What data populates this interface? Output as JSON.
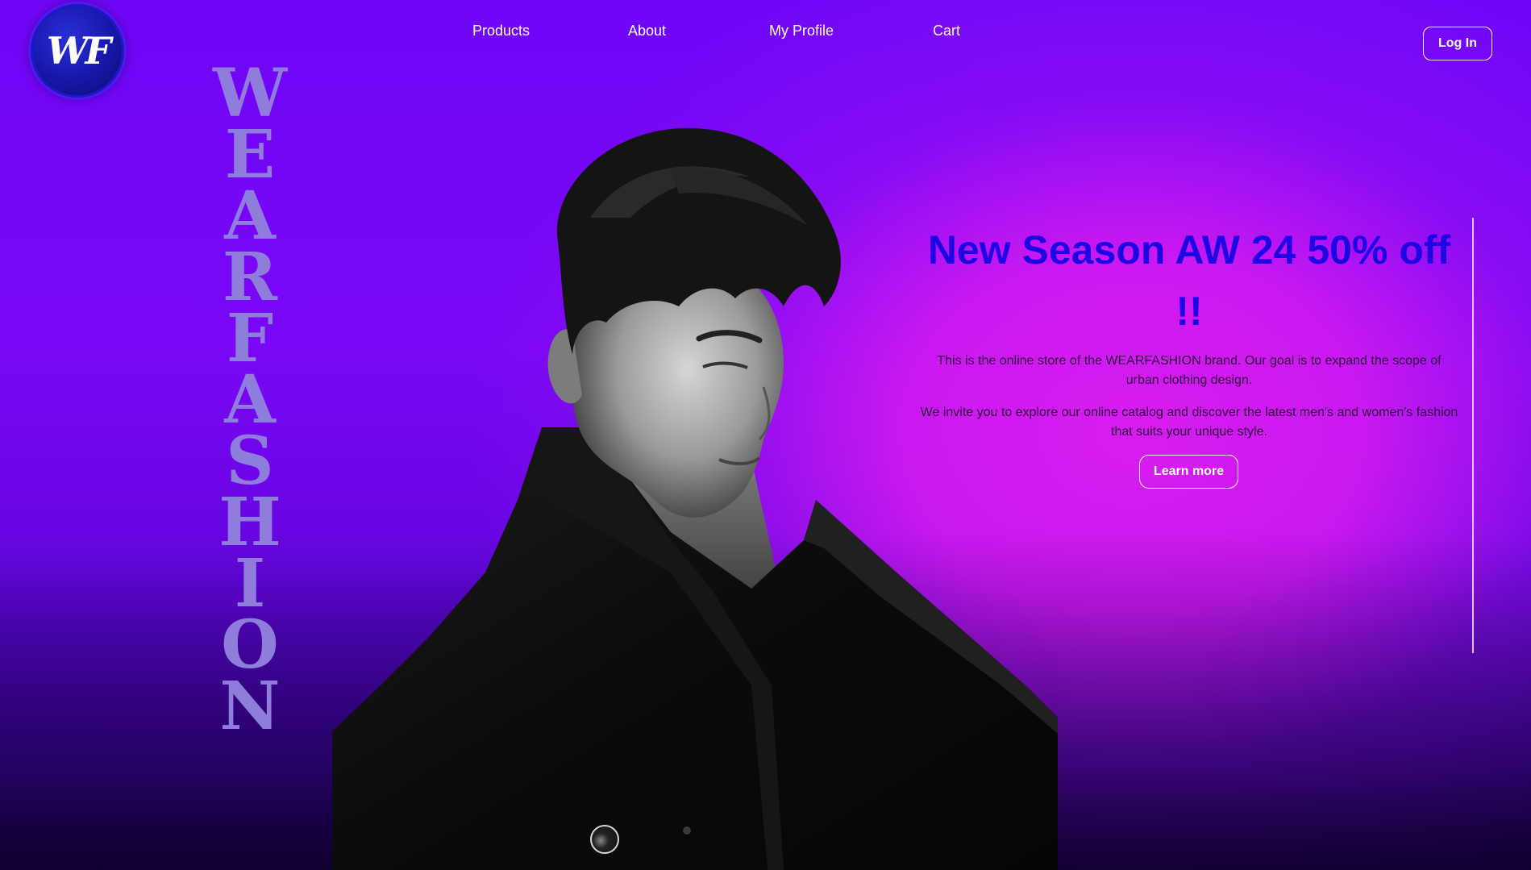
{
  "brand": {
    "logo_text": "WF",
    "vertical_name": "WEARFASHION"
  },
  "nav": {
    "items": [
      {
        "label": "Products"
      },
      {
        "label": "About"
      },
      {
        "label": "My Profile"
      },
      {
        "label": "Cart"
      }
    ],
    "login_label": "Log In"
  },
  "hero": {
    "headline": "New Season AW 24 50% off !!",
    "paragraph_1": "This is the online store of the WEARFASHION brand. Our goal is to expand the scope of urban clothing design.",
    "paragraph_2": "We invite you to explore our online catalog and discover the latest men's and women's fashion that suits your unique style.",
    "cta_label": "Learn more"
  },
  "colors": {
    "accent_headline": "#1e05e3",
    "background_top": "#6f06f8",
    "background_glow": "#d81cf0",
    "brand_vertical": "#8f7ddc"
  },
  "icons": {
    "logo": "wf-monogram-icon",
    "scroll_indicator": "scroll-dot-icon"
  }
}
